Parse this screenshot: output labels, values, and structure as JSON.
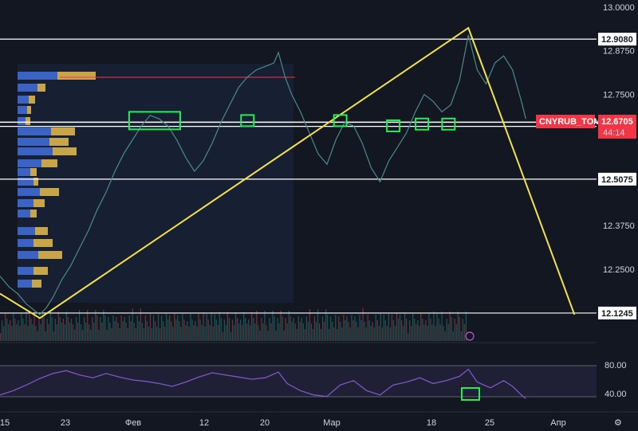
{
  "chart_data": {
    "type": "line",
    "symbol": "CNYRUB_TOM",
    "last_price": "12.6705",
    "countdown": "44:14",
    "y_ticks": [
      "13.0000",
      "12.8750",
      "12.7500",
      "12.3750",
      "12.2500"
    ],
    "key_levels": [
      "12.9080",
      "12.6585",
      "12.5075",
      "12.1245"
    ],
    "x_ticks": [
      "15",
      "23",
      "Фев",
      "12",
      "20",
      "Мар",
      "18",
      "25",
      "Апр"
    ],
    "rsi_ticks": [
      "80.00",
      "40.00"
    ],
    "price_series": [
      [
        0,
        12.23
      ],
      [
        4,
        12.2
      ],
      [
        8,
        12.18
      ],
      [
        12,
        12.15
      ],
      [
        16,
        12.13
      ],
      [
        18,
        12.12
      ],
      [
        21,
        12.14
      ],
      [
        24,
        12.17
      ],
      [
        28,
        12.22
      ],
      [
        32,
        12.26
      ],
      [
        36,
        12.31
      ],
      [
        40,
        12.36
      ],
      [
        44,
        12.42
      ],
      [
        48,
        12.47
      ],
      [
        52,
        12.53
      ],
      [
        56,
        12.58
      ],
      [
        60,
        12.62
      ],
      [
        64,
        12.66
      ],
      [
        68,
        12.69
      ],
      [
        72,
        12.68
      ],
      [
        76,
        12.66
      ],
      [
        80,
        12.62
      ],
      [
        84,
        12.57
      ],
      [
        88,
        12.53
      ],
      [
        92,
        12.56
      ],
      [
        96,
        12.61
      ],
      [
        100,
        12.67
      ],
      [
        104,
        12.72
      ],
      [
        108,
        12.77
      ],
      [
        112,
        12.8
      ],
      [
        116,
        12.82
      ],
      [
        120,
        12.83
      ],
      [
        124,
        12.84
      ],
      [
        126,
        12.87
      ],
      [
        129,
        12.8
      ],
      [
        132,
        12.75
      ],
      [
        136,
        12.7
      ],
      [
        140,
        12.64
      ],
      [
        144,
        12.58
      ],
      [
        148,
        12.55
      ],
      [
        152,
        12.62
      ],
      [
        156,
        12.67
      ],
      [
        160,
        12.66
      ],
      [
        164,
        12.61
      ],
      [
        168,
        12.54
      ],
      [
        172,
        12.5
      ],
      [
        176,
        12.56
      ],
      [
        180,
        12.6
      ],
      [
        184,
        12.64
      ],
      [
        188,
        12.7
      ],
      [
        192,
        12.75
      ],
      [
        196,
        12.73
      ],
      [
        200,
        12.7
      ],
      [
        204,
        12.72
      ],
      [
        208,
        12.79
      ],
      [
        212,
        12.92
      ],
      [
        216,
        12.82
      ],
      [
        220,
        12.78
      ],
      [
        224,
        12.84
      ],
      [
        228,
        12.86
      ],
      [
        232,
        12.82
      ],
      [
        236,
        12.73
      ],
      [
        238,
        12.68
      ]
    ],
    "zigzag": [
      [
        0,
        12.18
      ],
      [
        18,
        12.11
      ],
      [
        212,
        12.94
      ],
      [
        260,
        12.12
      ]
    ],
    "supply_zone_markers": [
      [
        70,
        12.675
      ],
      [
        112,
        12.675
      ],
      [
        154,
        12.675
      ],
      [
        178,
        12.66
      ],
      [
        191,
        12.665
      ],
      [
        203,
        12.665
      ]
    ],
    "rsi_series": [
      [
        0,
        38
      ],
      [
        6,
        44
      ],
      [
        12,
        52
      ],
      [
        18,
        61
      ],
      [
        24,
        68
      ],
      [
        30,
        72
      ],
      [
        36,
        66
      ],
      [
        42,
        62
      ],
      [
        48,
        68
      ],
      [
        54,
        63
      ],
      [
        60,
        59
      ],
      [
        66,
        57
      ],
      [
        72,
        54
      ],
      [
        78,
        50
      ],
      [
        84,
        56
      ],
      [
        90,
        63
      ],
      [
        96,
        69
      ],
      [
        102,
        66
      ],
      [
        108,
        63
      ],
      [
        114,
        60
      ],
      [
        120,
        62
      ],
      [
        126,
        70
      ],
      [
        130,
        54
      ],
      [
        136,
        44
      ],
      [
        142,
        38
      ],
      [
        148,
        36
      ],
      [
        154,
        52
      ],
      [
        160,
        58
      ],
      [
        166,
        44
      ],
      [
        172,
        38
      ],
      [
        178,
        52
      ],
      [
        184,
        56
      ],
      [
        190,
        62
      ],
      [
        196,
        54
      ],
      [
        202,
        58
      ],
      [
        208,
        64
      ],
      [
        212,
        74
      ],
      [
        216,
        56
      ],
      [
        222,
        48
      ],
      [
        228,
        58
      ],
      [
        232,
        50
      ],
      [
        236,
        38
      ],
      [
        238,
        33
      ]
    ],
    "rsi_range": [
      20,
      100
    ],
    "y_range": [
      12.04,
      13.02
    ],
    "x_range": [
      0,
      270
    ]
  },
  "colors": {
    "background": "#131722",
    "price_line": "#4a8a8a",
    "zigzag": "#f2e24b",
    "level_line": "#ffffff",
    "marker_box": "#22ee55",
    "symbol_tag": "#f23645",
    "rsi_line": "#7e57c2",
    "volume_up": "#26a69a",
    "volume_down": "#ef5350"
  }
}
